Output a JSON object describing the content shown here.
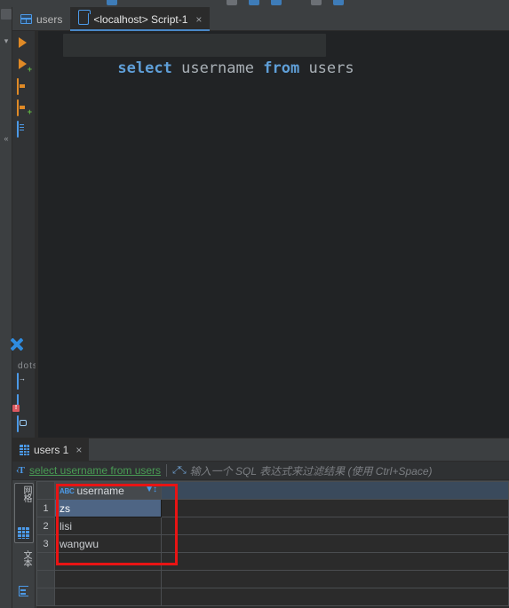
{
  "window": {
    "theme_bg": "#3c3f41",
    "editor_bg": "#212325",
    "accent": "#4c9ae8",
    "annotation_color": "#e81414"
  },
  "toolbar": {
    "icons": [
      "db-icon",
      "table-icon",
      "console-icon",
      "run-icon"
    ]
  },
  "left_strip": {
    "top_icon": "panel-icon",
    "caret": "▾",
    "collapse": "«"
  },
  "editor_tabs": [
    {
      "label": "users",
      "icon": "table-icon",
      "active": false,
      "closable": false
    },
    {
      "label": "<localhost> Script-1",
      "icon": "console-icon",
      "active": true,
      "closable": true,
      "close": "×"
    }
  ],
  "gutter_icons": [
    {
      "name": "run-statement-icon",
      "glyph": "play"
    },
    {
      "name": "run-script-add-icon",
      "glyph": "play-plus"
    },
    {
      "name": "execute-script-icon",
      "glyph": "script"
    },
    {
      "name": "execute-script-add-icon",
      "glyph": "script-plus"
    },
    {
      "name": "open-console-icon",
      "glyph": "doc-blue"
    },
    {
      "name": "settings-icon",
      "glyph": "gear-blue"
    },
    {
      "name": "more-options-icon",
      "glyph": "dots"
    },
    {
      "name": "export-data-icon",
      "glyph": "doc-arrow"
    },
    {
      "name": "error-log-icon",
      "glyph": "doc-error"
    },
    {
      "name": "database-doc-icon",
      "glyph": "doc-db"
    }
  ],
  "editor": {
    "code": {
      "tokens": [
        {
          "text": "select",
          "type": "keyword"
        },
        {
          "text": " ",
          "type": "plain"
        },
        {
          "text": "username",
          "type": "identifier"
        },
        {
          "text": " ",
          "type": "plain"
        },
        {
          "text": "from",
          "type": "keyword"
        },
        {
          "text": " ",
          "type": "plain"
        },
        {
          "text": "users",
          "type": "identifier"
        }
      ],
      "plain_text": "select username from users"
    }
  },
  "results": {
    "tab": {
      "label": "users 1",
      "icon": "grid-icon",
      "close": "×"
    },
    "filter": {
      "type_icon": "text-filter-icon",
      "query": "select username from users",
      "expand_icon": "expand-icon",
      "placeholder": "输入一个 SQL 表达式来过滤结果 (使用 Ctrl+Space)"
    },
    "view_modes": [
      {
        "label": "网格",
        "name": "grid-view-toggle",
        "selected": true
      },
      {
        "label": "文本",
        "name": "text-view-toggle",
        "selected": false
      }
    ],
    "grid": {
      "columns": [
        {
          "label": "username",
          "type_badge": "ABC",
          "filter_icon": "filter-icon",
          "sort_icon": "sort-icon"
        }
      ],
      "rows": [
        {
          "number": "1",
          "values": [
            "zs"
          ],
          "selected": true
        },
        {
          "number": "2",
          "values": [
            "lisi"
          ],
          "selected": false
        },
        {
          "number": "3",
          "values": [
            "wangwu"
          ],
          "selected": false
        }
      ],
      "blank_row_count": 3
    }
  },
  "annotation": {
    "shape": "rectangle",
    "color": "#e81414",
    "target": "username-column"
  }
}
